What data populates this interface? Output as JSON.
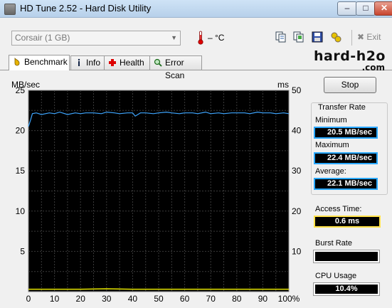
{
  "window": {
    "title": "HD Tune 2.52 - Hard Disk Utility",
    "min": "–",
    "max": "□",
    "close": "✕"
  },
  "toolbar": {
    "drive": "Corsair (1 GB)",
    "temperature": "– °C",
    "exit_label": "Exit",
    "icons": [
      "copy-info-icon",
      "copy-screenshot-icon",
      "save-icon",
      "options-icon"
    ]
  },
  "tabs": [
    {
      "label": "Benchmark",
      "icon": "benchmark-icon",
      "active": true
    },
    {
      "label": "Info",
      "icon": "info-icon",
      "active": false
    },
    {
      "label": "Health",
      "icon": "health-icon",
      "active": false
    },
    {
      "label": "Error Scan",
      "icon": "error-scan-icon",
      "active": false
    }
  ],
  "logo": {
    "main": "hard-h2o",
    "sub": ".com"
  },
  "controls": {
    "stop_label": "Stop"
  },
  "stats": {
    "transfer_rate_title": "Transfer Rate",
    "minimum_label": "Minimum",
    "minimum_value": "20.5 MB/sec",
    "maximum_label": "Maximum",
    "maximum_value": "22.4 MB/sec",
    "average_label": "Average:",
    "average_value": "22.1 MB/sec",
    "access_time_label": "Access Time:",
    "access_time_value": "0.6 ms",
    "burst_rate_label": "Burst Rate",
    "burst_rate_value": "",
    "cpu_usage_label": "CPU Usage",
    "cpu_usage_value": "10.4%"
  },
  "chart_data": {
    "type": "line",
    "left_unit": "MB/sec",
    "right_unit": "ms",
    "ylim_left": [
      0,
      25
    ],
    "ylim_right": [
      0,
      50
    ],
    "y_ticks_left": [
      5,
      10,
      15,
      20,
      25
    ],
    "y_ticks_right": [
      10,
      20,
      30,
      40,
      50
    ],
    "x_ticks": [
      "0",
      "10",
      "20",
      "30",
      "40",
      "50",
      "60",
      "70",
      "80",
      "90",
      "100%"
    ],
    "grid": true,
    "colors": {
      "background": "#000000",
      "grid": "#3a3a3a",
      "transfer": "#3ea6ff",
      "access": "#e6e600"
    },
    "series": [
      {
        "values_x": [
          0,
          0.8,
          1.5,
          3,
          5,
          8,
          10,
          12,
          15,
          18,
          20,
          22,
          25,
          28,
          30,
          33,
          35,
          38,
          40,
          41,
          43,
          45,
          48,
          50,
          53,
          55,
          58,
          60,
          63,
          65,
          68,
          70,
          73,
          75,
          78,
          80,
          83,
          85,
          88,
          90,
          93,
          95,
          98,
          100
        ],
        "values_y": [
          20.5,
          21.3,
          22.1,
          22.2,
          22.0,
          22.2,
          22.1,
          22.3,
          22.0,
          22.2,
          22.1,
          22.2,
          22.2,
          22.1,
          22.3,
          22.2,
          22.1,
          22.2,
          22.2,
          21.8,
          22.2,
          22.2,
          22.1,
          22.2,
          22.3,
          22.2,
          22.1,
          22.2,
          22.2,
          22.1,
          22.3,
          22.1,
          22.2,
          22.1,
          22.2,
          22.2,
          22.2,
          22.1,
          22.3,
          22.2,
          22.2,
          22.1,
          22.2,
          22.1
        ]
      },
      {
        "values_x": [
          0,
          10,
          20,
          30,
          40,
          50,
          60,
          70,
          80,
          90,
          100
        ],
        "values_y": [
          0.6,
          0.6,
          0.6,
          0.7,
          0.6,
          0.6,
          0.6,
          0.6,
          0.6,
          0.6,
          0.6
        ]
      }
    ]
  }
}
